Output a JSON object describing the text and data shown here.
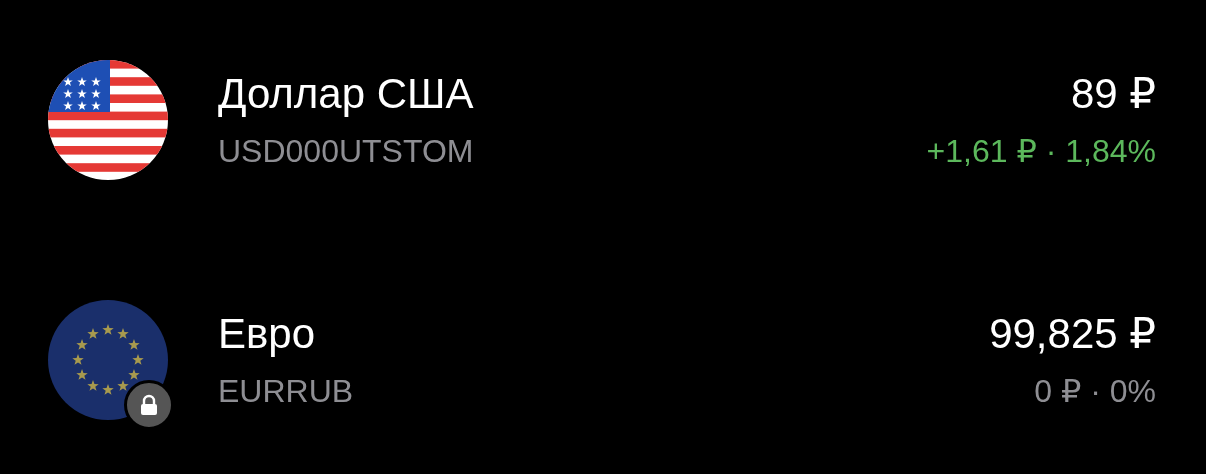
{
  "instruments": [
    {
      "flag": {
        "kind": "us"
      },
      "name": "Доллар США",
      "ticker": "USD000UTSTOM",
      "price": "89 ₽",
      "change": {
        "text": "+1,61 ₽ · 1,84%",
        "kind": "up"
      },
      "locked": false
    },
    {
      "flag": {
        "kind": "eu"
      },
      "name": "Евро",
      "ticker": "EURRUB",
      "price": "99,825 ₽",
      "change": {
        "text": "0 ₽ · 0%",
        "kind": "flat"
      },
      "locked": true
    }
  ]
}
